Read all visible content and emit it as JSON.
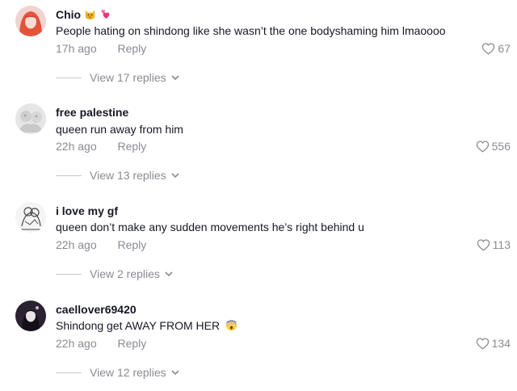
{
  "comments": [
    {
      "username": "Chio",
      "username_emojis": [
        "cat-face-emoji",
        "two-hearts-emoji"
      ],
      "text": "People hating on shindong like she wasn’t the one bodyshaming him lmaoooo",
      "time": "17h ago",
      "reply_label": "Reply",
      "likes": "67",
      "view_replies": "View 17 replies"
    },
    {
      "username": "free palestine",
      "text": "queen run away from him",
      "time": "22h ago",
      "reply_label": "Reply",
      "likes": "556",
      "view_replies": "View 13 replies"
    },
    {
      "username": "i love my gf",
      "text": "queen don’t make any sudden movements he’s right behind u",
      "time": "22h ago",
      "reply_label": "Reply",
      "likes": "113",
      "view_replies": "View 2 replies"
    },
    {
      "username": "caellover69420",
      "text": "Shindong get AWAY FROM HER",
      "text_emoji": "scream-emoji",
      "time": "22h ago",
      "reply_label": "Reply",
      "likes": "134",
      "view_replies": "View 12 replies"
    }
  ],
  "colors": {
    "text": "#161823",
    "muted": "#8a8b91",
    "divider": "#c8c9cc"
  }
}
